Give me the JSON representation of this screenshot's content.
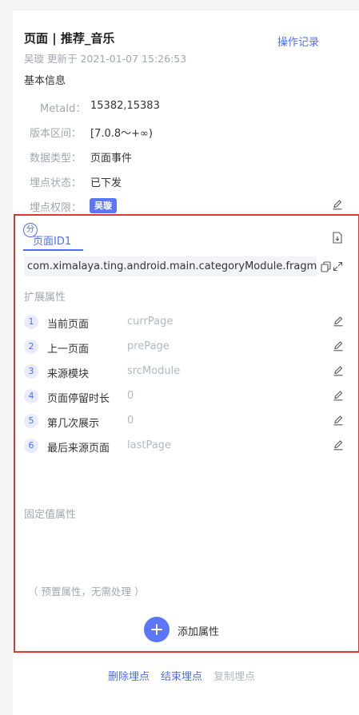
{
  "header": {
    "title": "页面 | 推荐_音乐",
    "operation_log": "操作记录",
    "updated": "吴璇 更新于 2021-01-07 15:26:53"
  },
  "basic": {
    "section_title": "基本信息",
    "fields": [
      {
        "label": "MetaId：",
        "value": "15382,15383"
      },
      {
        "label": "版本区间：",
        "value": "[7.0.8～+∞)"
      },
      {
        "label": "数据类型：",
        "value": "页面事件"
      },
      {
        "label": "埋点状态：",
        "value": "已下发"
      },
      {
        "label": "埋点权限：",
        "value": "吴璇"
      }
    ]
  },
  "page_tab": {
    "badge": "分",
    "label": "页面ID1",
    "url": "com.ximalaya.ting.android.main.categoryModule.fragment"
  },
  "ext": {
    "section_title": "扩展属性",
    "items": [
      {
        "num": "1",
        "name": "当前页面",
        "key": "currPage"
      },
      {
        "num": "2",
        "name": "上一页面",
        "key": "prePage"
      },
      {
        "num": "3",
        "name": "来源模块",
        "key": "srcModule"
      },
      {
        "num": "4",
        "name": "页面停留时长",
        "key": "0"
      },
      {
        "num": "5",
        "name": "第几次展示",
        "key": "0"
      },
      {
        "num": "6",
        "name": "最后来源页面",
        "key": "lastPage"
      }
    ]
  },
  "fixed": {
    "section_title": "固定值属性",
    "preset_note": "（ 预置属性，无需处理 ）"
  },
  "add": {
    "plus": "+",
    "label": "添加属性"
  },
  "footer": {
    "delete": "删除埋点",
    "finish": "结束埋点",
    "copy": "复制埋点"
  },
  "colors": {
    "accent": "#4f6ef7",
    "highlight_box": "#d93a35",
    "muted": "#a3a7ae"
  },
  "icons": [
    "edit-icon",
    "export-doc-icon",
    "copy-icon",
    "expand-icon",
    "plus-icon"
  ]
}
